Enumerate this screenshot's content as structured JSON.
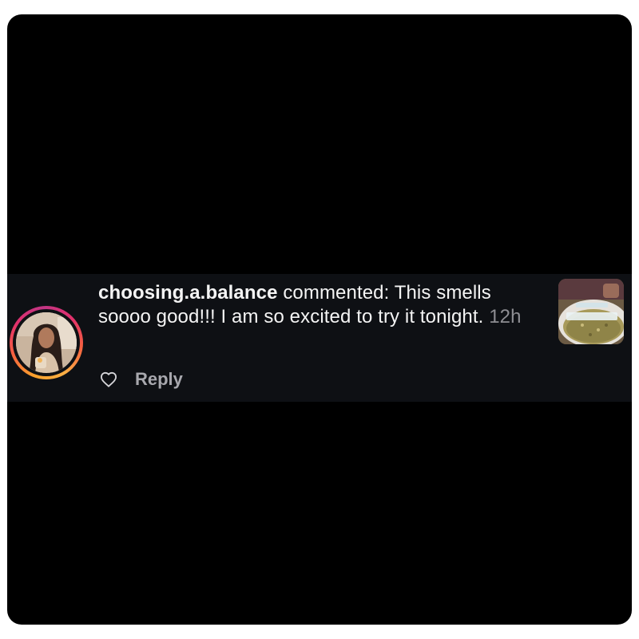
{
  "notification": {
    "username": "choosing.a.balance",
    "action": "commented:",
    "comment": "This smells soooo good!!! I am so excited to try it tonight.",
    "time": "12h",
    "reply_label": "Reply"
  },
  "icons": {
    "like": "heart-outline-icon"
  },
  "colors": {
    "background": "#000000",
    "notification_bg": "#0e1014",
    "text": "#f4f4f4",
    "muted": "#8e8e93",
    "ring_start": "#f9a12c",
    "ring_end": "#c13584"
  }
}
